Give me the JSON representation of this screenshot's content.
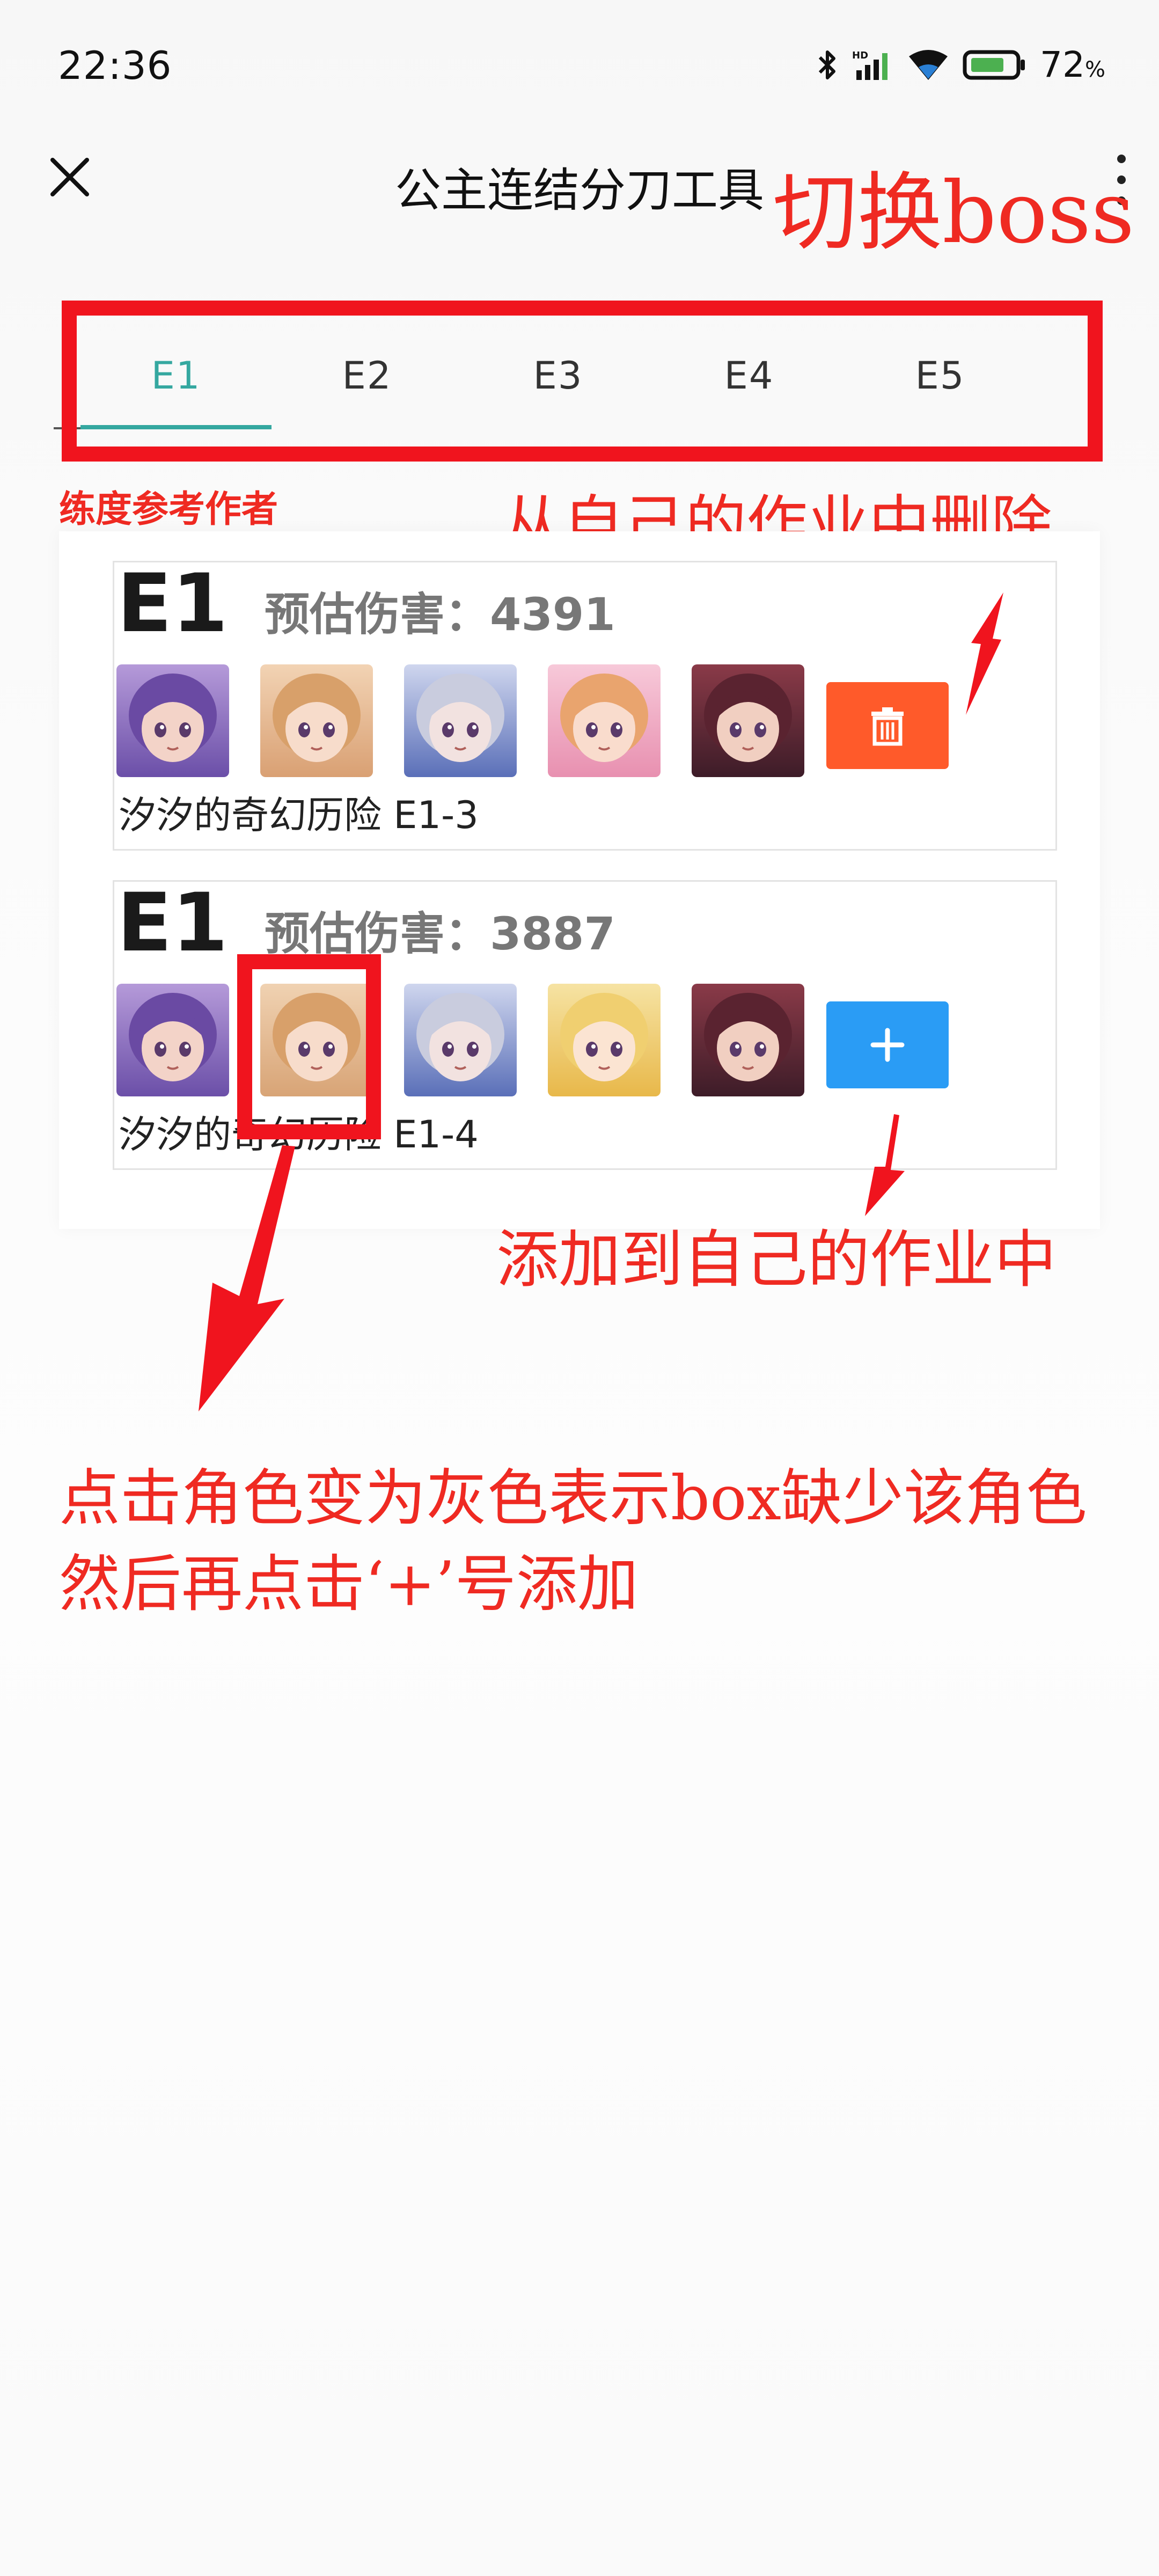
{
  "status_bar": {
    "time": "22:36",
    "battery_pct": "72",
    "battery_unit": "%",
    "icons": [
      "bluetooth-icon",
      "hd-signal-icon",
      "wifi-icon",
      "battery-icon"
    ]
  },
  "app_bar": {
    "title": "公主连结分刀工具",
    "close_icon": "close-icon",
    "more_icon": "more-vert-icon"
  },
  "tabs": [
    {
      "label": "E1",
      "active": true
    },
    {
      "label": "E2",
      "active": false
    },
    {
      "label": "E3",
      "active": false
    },
    {
      "label": "E4",
      "active": false
    },
    {
      "label": "E5",
      "active": false
    }
  ],
  "section_label": "练度参考作者",
  "rows": [
    {
      "boss": "E1",
      "damage": "预估伤害：4391",
      "caption": "汐汐的奇幻历险 E1-3",
      "action": "delete",
      "avatars": [
        {
          "bg": [
            "#b59ad9",
            "#6b4fa8"
          ],
          "hair": "#6a4aa3",
          "skin": "#f3d3c8"
        },
        {
          "bg": [
            "#f2d3b4",
            "#d9a073"
          ],
          "hair": "#d8a06a",
          "skin": "#f7dccb"
        },
        {
          "bg": [
            "#cfd6ee",
            "#5a6fb8"
          ],
          "hair": "#c9ccde",
          "skin": "#f2e2e0"
        },
        {
          "bg": [
            "#f7c9d9",
            "#e890b0"
          ],
          "hair": "#e9a46e",
          "skin": "#f9dccd"
        },
        {
          "bg": [
            "#8a3a48",
            "#3d1c28"
          ],
          "hair": "#5a2330",
          "skin": "#f1cfc1"
        }
      ]
    },
    {
      "boss": "E1",
      "damage": "预估伤害：3887",
      "caption": "汐汐的奇幻历险 E1-4",
      "action": "add",
      "avatars": [
        {
          "bg": [
            "#b59ad9",
            "#6b4fa8"
          ],
          "hair": "#6a4aa3",
          "skin": "#f3d3c8"
        },
        {
          "bg": [
            "#f0d2b2",
            "#d8a476"
          ],
          "hair": "#d8a06a",
          "skin": "#f7dccb"
        },
        {
          "bg": [
            "#cfd6ee",
            "#5a6fb8"
          ],
          "hair": "#c9ccde",
          "skin": "#f2e2e0"
        },
        {
          "bg": [
            "#f6e3a3",
            "#e8b84a"
          ],
          "hair": "#f0cf70",
          "skin": "#fbe4d2"
        },
        {
          "bg": [
            "#8a3a48",
            "#3d1c28"
          ],
          "hair": "#5a2330",
          "skin": "#f1cfc1"
        }
      ]
    }
  ],
  "annotations": {
    "switch_boss": "切换boss",
    "delete_note": "从自己的作业中删除",
    "add_note": "添加到自己的作业中",
    "tip_line1": "点击角色变为灰色表示box缺少该角色",
    "tip_line2": "然后再点击‘+’号添加"
  },
  "colors": {
    "accent": "#35a8a0",
    "annotation_red": "#f0141e",
    "delete_btn": "#ff5a2a",
    "add_btn": "#2a9cf5"
  }
}
